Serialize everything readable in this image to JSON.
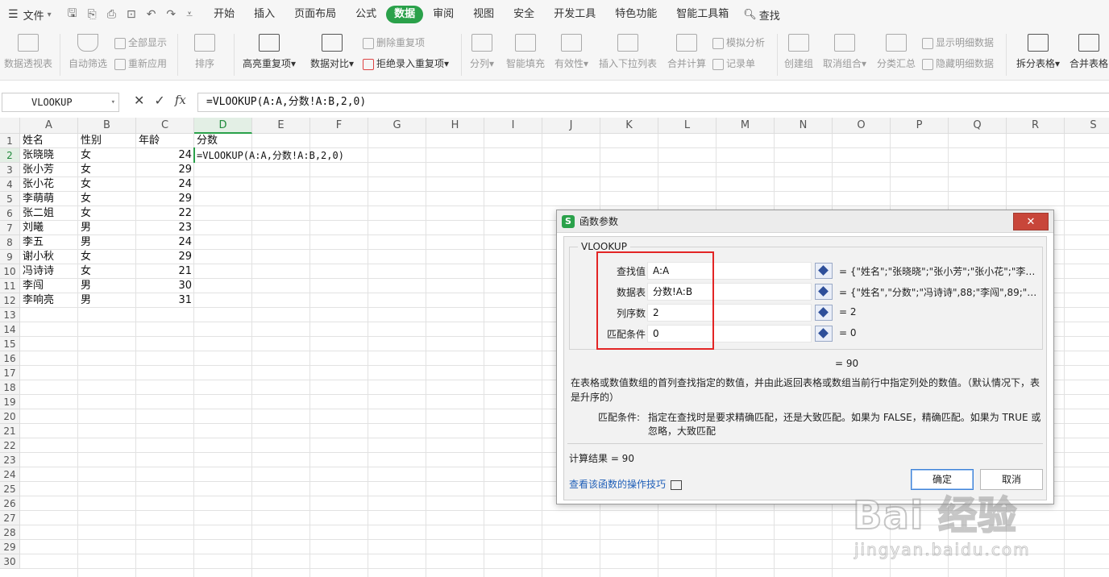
{
  "menubar": {
    "file": "文件",
    "tabs": [
      "开始",
      "插入",
      "页面布局",
      "公式",
      "数据",
      "审阅",
      "视图",
      "安全",
      "开发工具",
      "特色功能",
      "智能工具箱"
    ],
    "active_tab": "数据",
    "search": "查找"
  },
  "ribbon": {
    "pivot": "数据透视表",
    "autofilter": "自动筛选",
    "show_all": "全部显示",
    "reapply": "重新应用",
    "sort": "排序",
    "highlight_dup": "高亮重复项",
    "data_compare": "数据对比",
    "remove_dup": "删除重复项",
    "reject_dup": "拒绝录入重复项",
    "split": "分列",
    "smart_fill": "智能填充",
    "validity": "有效性",
    "insert_dropdown": "插入下拉列表",
    "merge_calc": "合并计算",
    "simulate": "模拟分析",
    "record": "记录单",
    "create_group": "创建组",
    "ungroup": "取消组合",
    "subtotal": "分类汇总",
    "show_detail": "显示明细数据",
    "hide_detail": "隐藏明细数据",
    "split_table": "拆分表格",
    "merge_table": "合并表格"
  },
  "formula_bar": {
    "name_box": "VLOOKUP",
    "formula": "=VLOOKUP(A:A,分数!A:B,2,0)"
  },
  "sheet": {
    "columns": [
      "A",
      "B",
      "C",
      "D",
      "E",
      "F",
      "G",
      "H",
      "I",
      "J",
      "K",
      "L",
      "M",
      "N",
      "O",
      "P",
      "Q",
      "R",
      "S"
    ],
    "row_numbers": [
      "1",
      "2",
      "3",
      "4",
      "5",
      "6",
      "7",
      "8",
      "9",
      "10",
      "11",
      "12",
      "13",
      "14",
      "15",
      "16",
      "17",
      "18",
      "19",
      "20",
      "21",
      "22",
      "23",
      "24",
      "25",
      "26",
      "27",
      "28",
      "29",
      "30"
    ],
    "headers": [
      "姓名",
      "性别",
      "年龄",
      "分数"
    ],
    "rows": [
      [
        "张晓晓",
        "女",
        "24"
      ],
      [
        "张小芳",
        "女",
        "29"
      ],
      [
        "张小花",
        "女",
        "24"
      ],
      [
        "李萌萌",
        "女",
        "29"
      ],
      [
        "张二姐",
        "女",
        "22"
      ],
      [
        "刘曦",
        "男",
        "23"
      ],
      [
        "李五",
        "男",
        "24"
      ],
      [
        "谢小秋",
        "女",
        "29"
      ],
      [
        "冯诗诗",
        "女",
        "21"
      ],
      [
        "李闯",
        "男",
        "30"
      ],
      [
        "李响亮",
        "男",
        "31"
      ]
    ],
    "editing_formula": "=VLOOKUP(A:A,分数!A:B,2,0)"
  },
  "dialog": {
    "title": "函数参数",
    "close": "✕",
    "group": "VLOOKUP",
    "params": [
      {
        "label": "查找值",
        "value": "A:A",
        "result": "= {\"姓名\";\"张晓晓\";\"张小芳\";\"张小花\";\"李萌..."
      },
      {
        "label": "数据表",
        "value": "分数!A:B",
        "result": "= {\"姓名\",\"分数\";\"冯诗诗\",88;\"李闯\",89;\"李..."
      },
      {
        "label": "列序数",
        "value": "2",
        "result": "= 2"
      },
      {
        "label": "匹配条件",
        "value": "0",
        "result": "= 0"
      }
    ],
    "result_top": "=  90",
    "description": "在表格或数值数组的首列查找指定的数值，并由此返回表格或数组当前行中指定列处的数值。（默认情况下，表是升序的）",
    "detail_label": "匹配条件:",
    "detail_text": "指定在查找时是要求精确匹配，还是大致匹配。如果为 FALSE，精确匹配。如果为 TRUE 或忽略，大致匹配",
    "calc_result": "计算结果  =  90",
    "help_link": "查看该函数的操作技巧",
    "ok": "确定",
    "cancel": "取消"
  },
  "watermark": {
    "main": "Bai 经验",
    "sub": "jingyan.baidu.com"
  }
}
